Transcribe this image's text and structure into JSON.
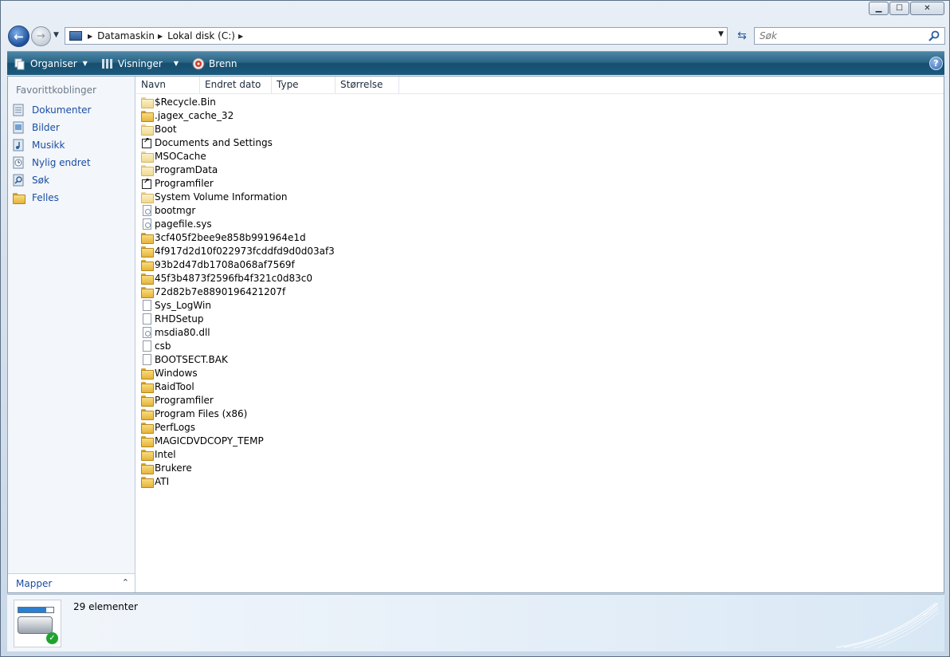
{
  "window": {
    "caption_buttons": [
      "minimize",
      "maximize",
      "close"
    ]
  },
  "navigation": {
    "breadcrumbs": [
      "Datamaskin",
      "Lokal disk (C:)"
    ],
    "search_placeholder": "Søk"
  },
  "toolbar": {
    "organize_label": "Organiser",
    "views_label": "Visninger",
    "burn_label": "Brenn"
  },
  "nav_pane": {
    "header": "Favorittkoblinger",
    "items": [
      {
        "label": "Dokumenter",
        "icon": "documents-icon"
      },
      {
        "label": "Bilder",
        "icon": "pictures-icon"
      },
      {
        "label": "Musikk",
        "icon": "music-icon"
      },
      {
        "label": "Nylig endret",
        "icon": "recently-changed-icon"
      },
      {
        "label": "Søk",
        "icon": "searches-icon"
      },
      {
        "label": "Felles",
        "icon": "public-folder-icon"
      }
    ],
    "folders_label": "Mapper"
  },
  "columns": [
    "Navn",
    "Endret dato",
    "Type",
    "Størrelse"
  ],
  "files": [
    {
      "name": "$Recycle.Bin",
      "icon": "folder-light"
    },
    {
      "name": ".jagex_cache_32",
      "icon": "folder"
    },
    {
      "name": "Boot",
      "icon": "folder-light"
    },
    {
      "name": "Documents and Settings",
      "icon": "shortcut"
    },
    {
      "name": "MSOCache",
      "icon": "folder-light"
    },
    {
      "name": "ProgramData",
      "icon": "folder-light"
    },
    {
      "name": "Programfiler",
      "icon": "shortcut"
    },
    {
      "name": "System Volume Information",
      "icon": "folder-light"
    },
    {
      "name": "bootmgr",
      "icon": "system-file"
    },
    {
      "name": "pagefile.sys",
      "icon": "system-file"
    },
    {
      "name": "3cf405f2bee9e858b991964e1d",
      "icon": "folder"
    },
    {
      "name": "4f917d2d10f022973fcddfd9d0d03af3",
      "icon": "folder"
    },
    {
      "name": "93b2d47db1708a068af7569f",
      "icon": "folder"
    },
    {
      "name": "45f3b4873f2596fb4f321c0d83c0",
      "icon": "folder"
    },
    {
      "name": "72d82b7e8890196421207f",
      "icon": "folder"
    },
    {
      "name": "Sys_LogWin",
      "icon": "document"
    },
    {
      "name": "RHDSetup",
      "icon": "document"
    },
    {
      "name": "msdia80.dll",
      "icon": "system-file"
    },
    {
      "name": "csb",
      "icon": "document"
    },
    {
      "name": "BOOTSECT.BAK",
      "icon": "document"
    },
    {
      "name": "Windows",
      "icon": "folder"
    },
    {
      "name": "RaidTool",
      "icon": "folder"
    },
    {
      "name": "Programfiler",
      "icon": "folder"
    },
    {
      "name": "Program Files (x86)",
      "icon": "folder"
    },
    {
      "name": "PerfLogs",
      "icon": "folder"
    },
    {
      "name": "MAGICDVDCOPY_TEMP",
      "icon": "folder"
    },
    {
      "name": "Intel",
      "icon": "folder"
    },
    {
      "name": "Brukere",
      "icon": "folder"
    },
    {
      "name": "ATI",
      "icon": "folder"
    }
  ],
  "details": {
    "item_count": "29 elementer",
    "icon": "local-disk-icon"
  },
  "colors": {
    "command_bar": "#1c5a7d",
    "link_blue": "#1a4ea3",
    "folder_yellow": "#e5b43a"
  }
}
